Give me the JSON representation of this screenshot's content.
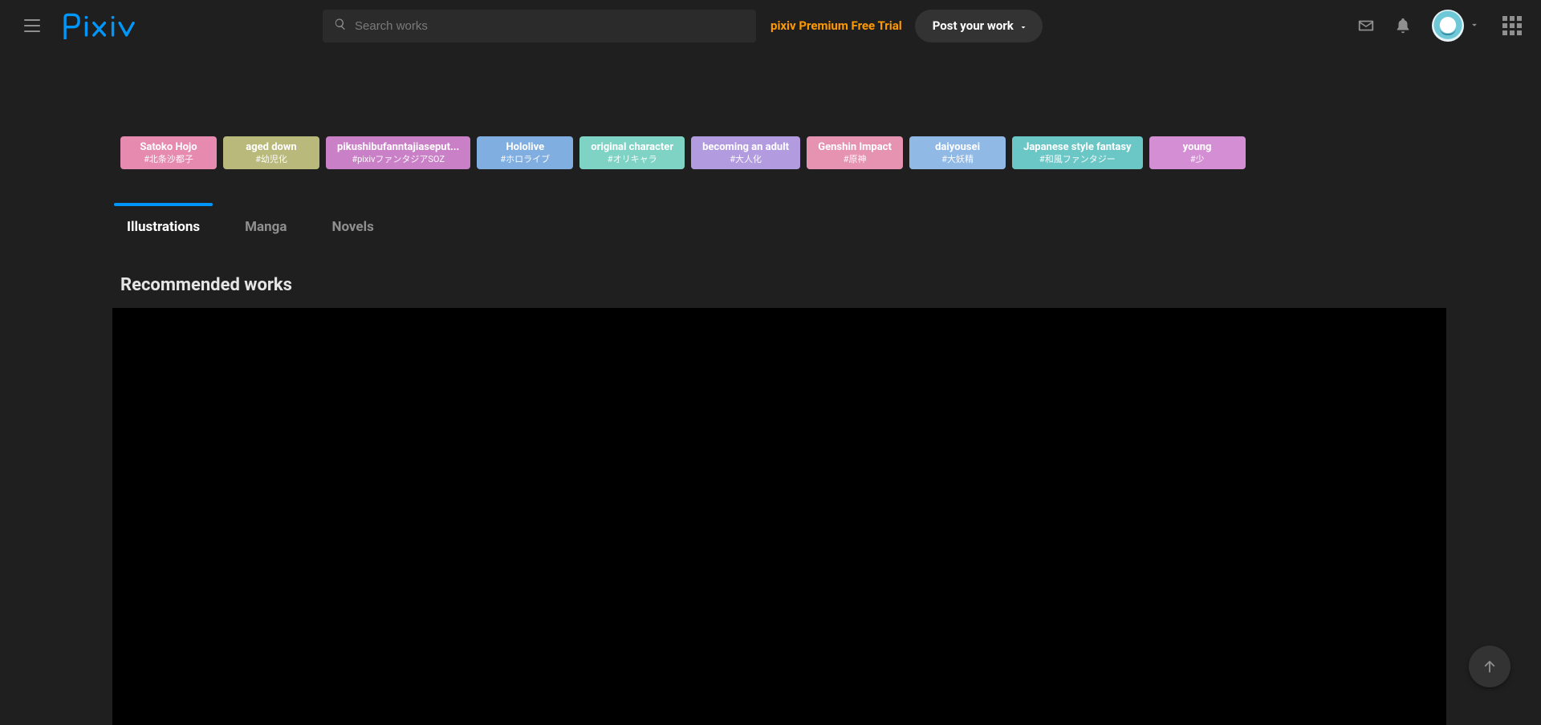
{
  "header": {
    "logo_text": "pixiv",
    "search_placeholder": "Search works",
    "premium_label": "pixiv Premium Free Trial",
    "post_label": "Post your work"
  },
  "tags": [
    {
      "label": "Satoko Hojo",
      "sub": "#北条沙都子",
      "color": "#e68ab0"
    },
    {
      "label": "aged down",
      "sub": "#幼児化",
      "color": "#b8b97a"
    },
    {
      "label": "pikushibufanntajiaseput...",
      "sub": "#pixivファンタジアSOZ",
      "color": "#c980c7"
    },
    {
      "label": "Hololive",
      "sub": "#ホロライブ",
      "color": "#81aee0"
    },
    {
      "label": "original character",
      "sub": "#オリキャラ",
      "color": "#7fd3c4"
    },
    {
      "label": "becoming an adult",
      "sub": "#大人化",
      "color": "#b39be0"
    },
    {
      "label": "Genshin Impact",
      "sub": "#原神",
      "color": "#e593b1"
    },
    {
      "label": "daiyousei",
      "sub": "#大妖精",
      "color": "#90b9e6"
    },
    {
      "label": "Japanese style fantasy",
      "sub": "#和風ファンタジー",
      "color": "#6bc6c6"
    },
    {
      "label": "young",
      "sub": "#少",
      "color": "#d48fd4"
    }
  ],
  "tabs": [
    {
      "label": "Illustrations",
      "active": true
    },
    {
      "label": "Manga",
      "active": false
    },
    {
      "label": "Novels",
      "active": false
    }
  ],
  "sections": {
    "recommended_title": "Recommended works"
  }
}
